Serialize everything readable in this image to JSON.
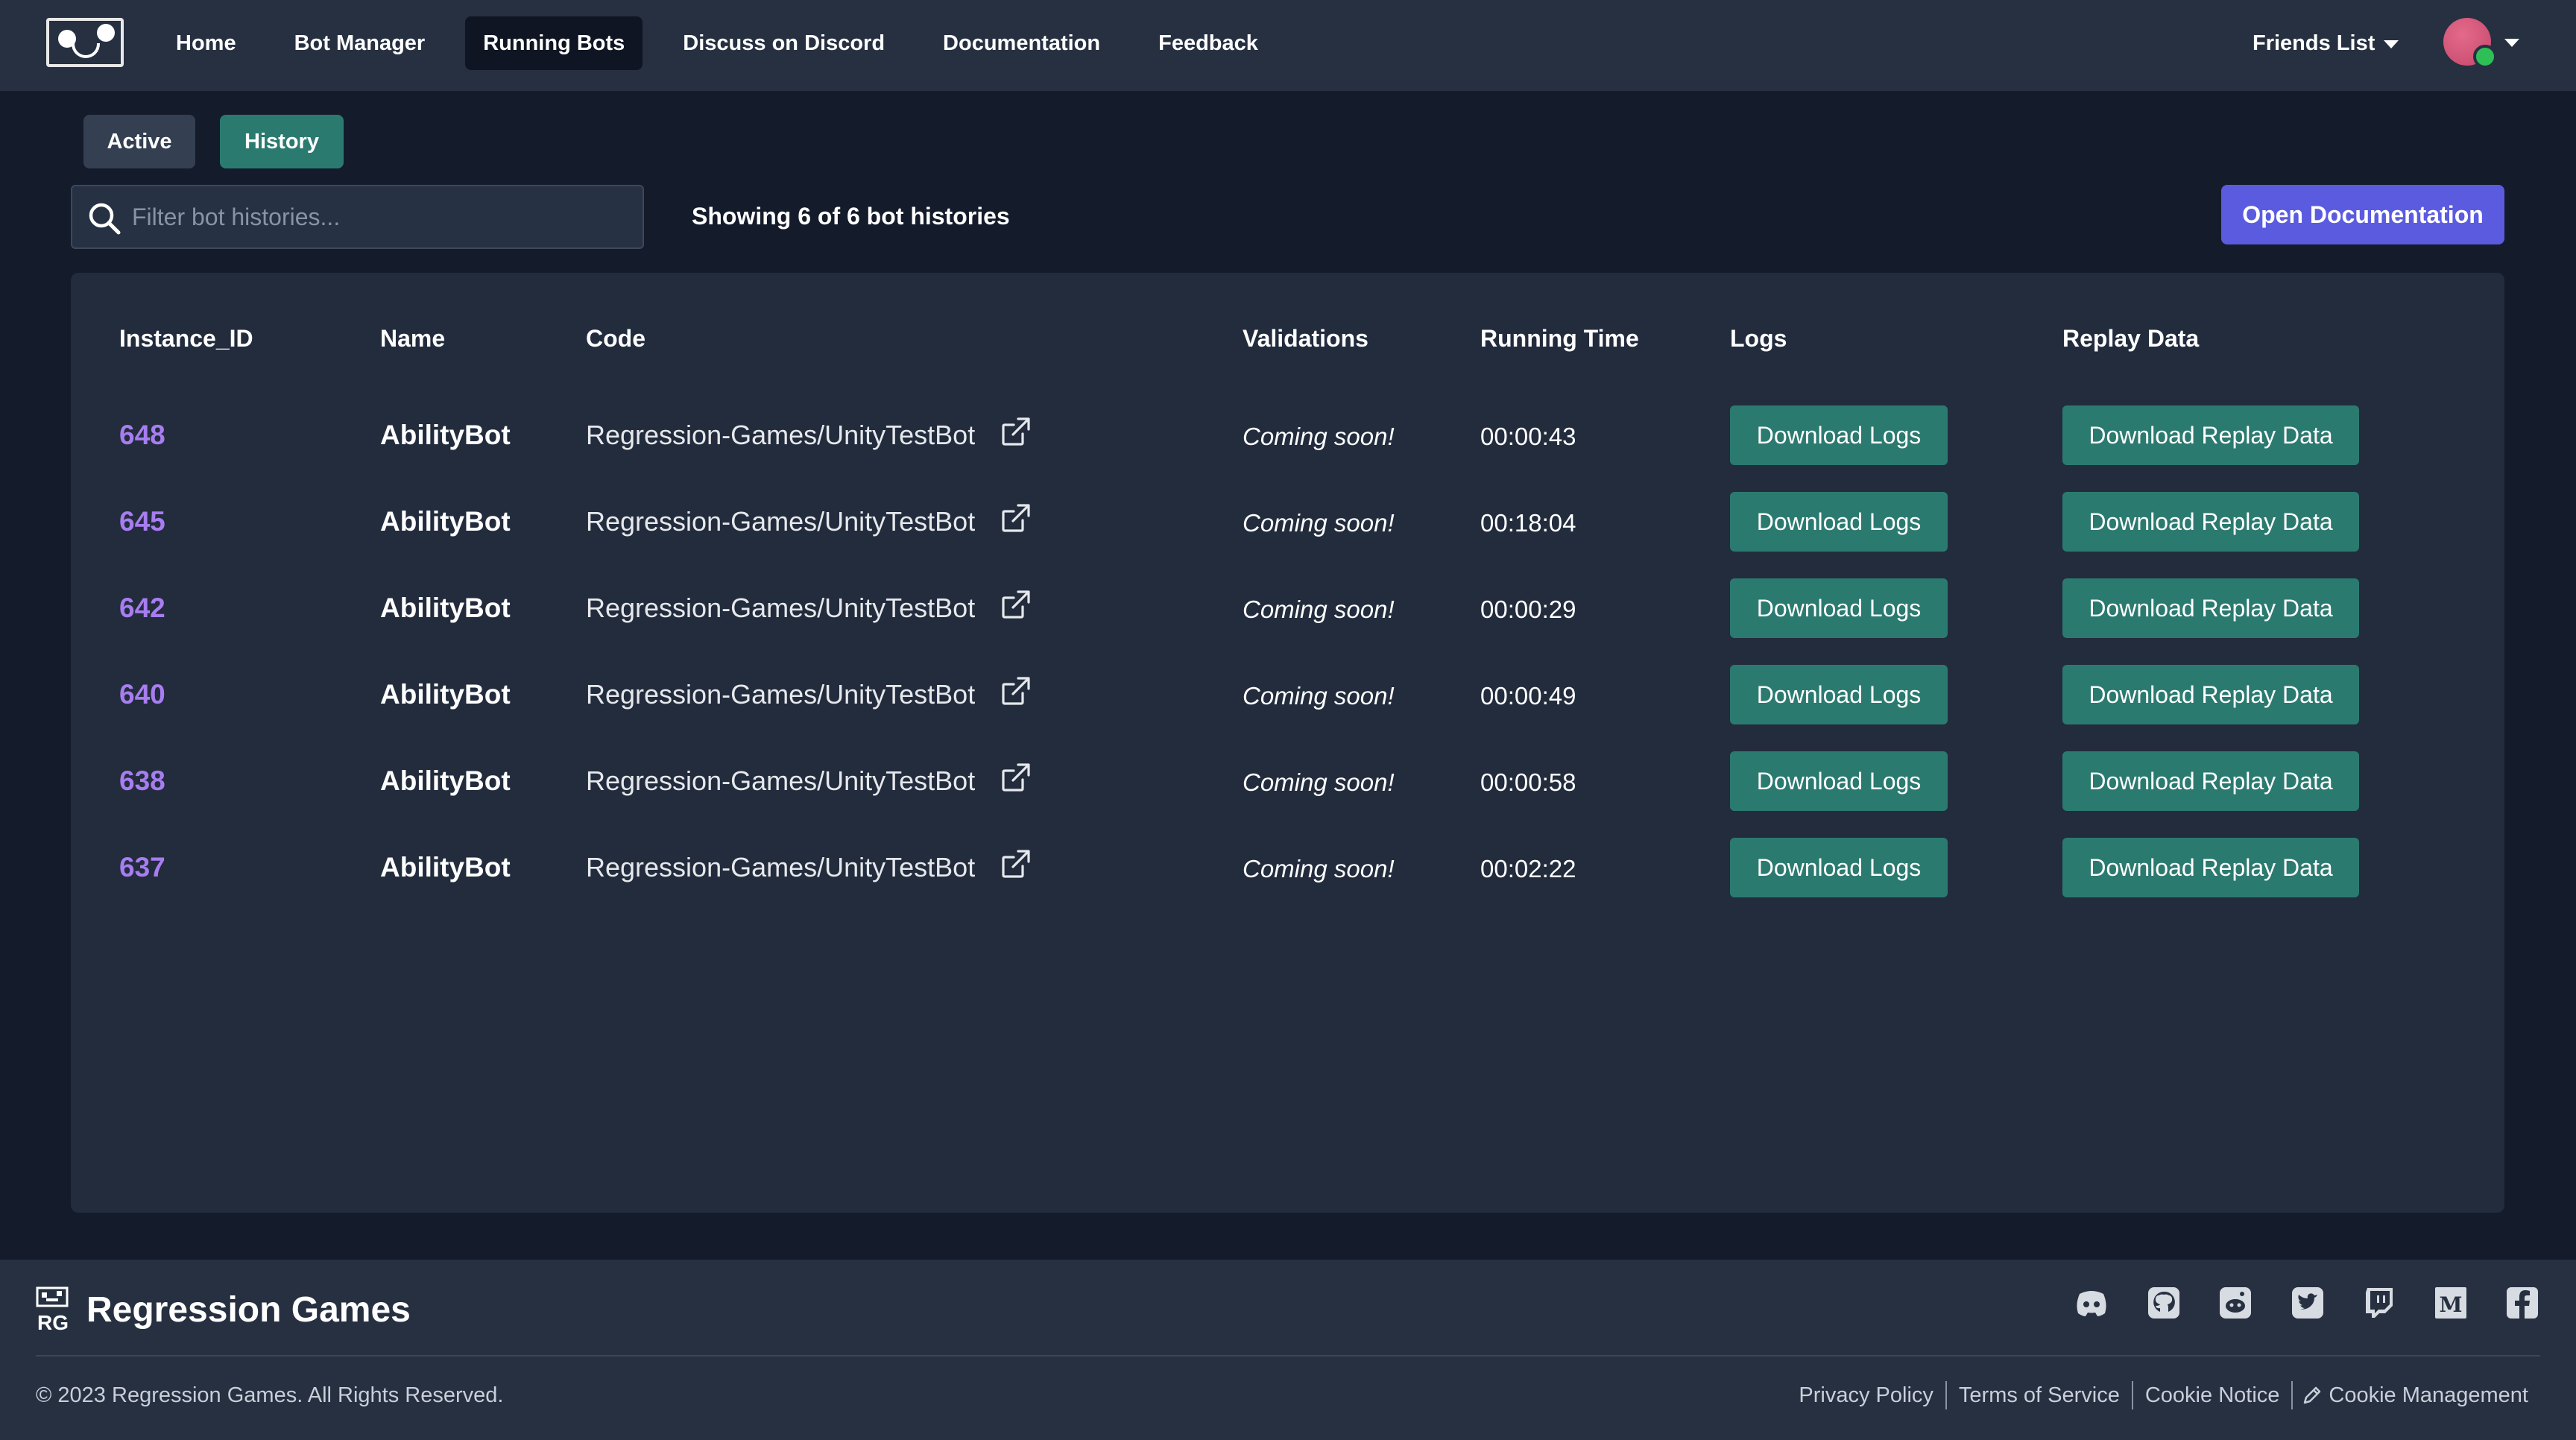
{
  "nav": {
    "links": [
      {
        "label": "Home"
      },
      {
        "label": "Bot Manager"
      },
      {
        "label": "Running Bots",
        "active": true
      },
      {
        "label": "Discuss on Discord"
      },
      {
        "label": "Documentation"
      },
      {
        "label": "Feedback"
      }
    ],
    "friends_label": "Friends List"
  },
  "tabs": {
    "active_label": "Active",
    "history_label": "History",
    "selected": "History"
  },
  "filter": {
    "placeholder": "Filter bot histories...",
    "value": ""
  },
  "showing_text": "Showing 6 of 6 bot histories",
  "open_doc_label": "Open Documentation",
  "table": {
    "headers": [
      "Instance_ID",
      "Name",
      "Code",
      "Validations",
      "Running Time",
      "Logs",
      "Replay Data"
    ],
    "rows": [
      {
        "id": "648",
        "name": "AbilityBot",
        "code": "Regression-Games/UnityTestBot",
        "validations": "Coming soon!",
        "running_time": "00:00:43",
        "logs_label": "Download Logs",
        "replay_label": "Download Replay Data"
      },
      {
        "id": "645",
        "name": "AbilityBot",
        "code": "Regression-Games/UnityTestBot",
        "validations": "Coming soon!",
        "running_time": "00:18:04",
        "logs_label": "Download Logs",
        "replay_label": "Download Replay Data"
      },
      {
        "id": "642",
        "name": "AbilityBot",
        "code": "Regression-Games/UnityTestBot",
        "validations": "Coming soon!",
        "running_time": "00:00:29",
        "logs_label": "Download Logs",
        "replay_label": "Download Replay Data"
      },
      {
        "id": "640",
        "name": "AbilityBot",
        "code": "Regression-Games/UnityTestBot",
        "validations": "Coming soon!",
        "running_time": "00:00:49",
        "logs_label": "Download Logs",
        "replay_label": "Download Replay Data"
      },
      {
        "id": "638",
        "name": "AbilityBot",
        "code": "Regression-Games/UnityTestBot",
        "validations": "Coming soon!",
        "running_time": "00:00:58",
        "logs_label": "Download Logs",
        "replay_label": "Download Replay Data"
      },
      {
        "id": "637",
        "name": "AbilityBot",
        "code": "Regression-Games/UnityTestBot",
        "validations": "Coming soon!",
        "running_time": "00:02:22",
        "logs_label": "Download Logs",
        "replay_label": "Download Replay Data"
      }
    ]
  },
  "footer": {
    "brand": "Regression Games",
    "copyright": "© 2023 Regression Games. All Rights Reserved.",
    "social_icons": [
      "discord-icon",
      "github-icon",
      "reddit-icon",
      "twitter-icon",
      "twitch-icon",
      "medium-icon",
      "facebook-icon"
    ],
    "links": [
      {
        "label": "Privacy Policy"
      },
      {
        "label": "Terms of Service"
      },
      {
        "label": "Cookie Notice"
      },
      {
        "label": "Cookie Management",
        "icon": "pencil-icon"
      }
    ]
  },
  "colors": {
    "page_bg": "#141b2a",
    "nav_bg": "#263041",
    "panel_bg": "#222c3d",
    "accent_teal": "#2b7a70",
    "accent_purple_button": "#5b5be0",
    "instance_id": "#a77df0",
    "online_status": "#2fbf57"
  }
}
